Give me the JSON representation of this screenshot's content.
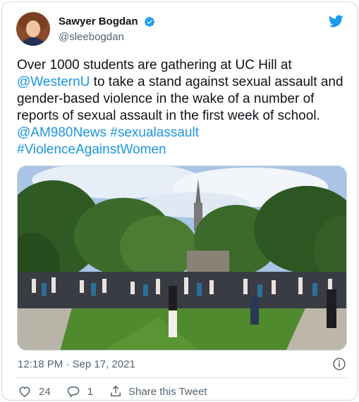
{
  "tweet": {
    "author": {
      "name": "Sawyer Bogdan",
      "handle": "@sleebogdan"
    },
    "text_parts": [
      {
        "text": "Over 1000 students are gathering at UC Hill at ",
        "link": false
      },
      {
        "text": "@WesternU",
        "link": true
      },
      {
        "text": " to take a stand against sexual assault and gender-based violence in the wake of a number of reports of sexual assault in the first week of school. ",
        "link": false
      },
      {
        "text": "@AM980News",
        "link": true
      },
      {
        "text": " ",
        "link": false
      },
      {
        "text": "#sexualassault",
        "link": true
      },
      {
        "text": " ",
        "link": false
      },
      {
        "text": "#ViolenceAgainstWomen",
        "link": true
      }
    ],
    "timestamp": "12:18 PM · Sep 17, 2021",
    "actions": {
      "like_count": "24",
      "reply_count": "1",
      "share_label": "Share this Tweet"
    }
  },
  "icons": {
    "verified": "verified-badge-icon",
    "twitter": "twitter-bird-icon",
    "info": "info-icon",
    "like": "heart-icon",
    "reply": "reply-bubble-icon",
    "share": "share-icon"
  },
  "colors": {
    "link": "#1b95e0",
    "twitter_blue": "#1d9bf0",
    "secondary_text": "#536471"
  }
}
